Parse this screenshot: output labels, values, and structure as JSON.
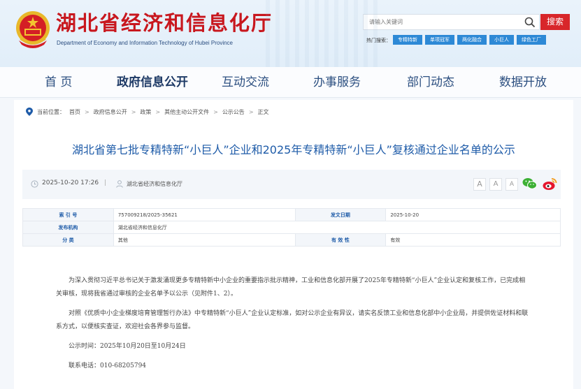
{
  "header": {
    "title": "湖北省经济和信息化厅",
    "subtitle": "Department of Economy and Information Technology of Hubei Province",
    "search_placeholder": "请输入关键词",
    "search_button": "搜索",
    "hot_label": "热门搜索：",
    "hot_tags": [
      "专精特新",
      "单项冠军",
      "两化融合",
      "小巨人",
      "绿色工厂"
    ]
  },
  "nav": {
    "items": [
      "首 页",
      "政府信息公开",
      "互动交流",
      "办事服务",
      "部门动态",
      "数据开放"
    ],
    "active_index": 1
  },
  "breadcrumb": {
    "label": "当前位置：",
    "items": [
      "首页",
      "政府信息公开",
      "政策",
      "其他主动公开文件",
      "公示公告",
      "正文"
    ],
    "separator": ">"
  },
  "article": {
    "title": "湖北省第七批专精特新“小巨人”企业和2025年专精特新“小巨人”复核通过企业名单的公示",
    "date": "2025-10-20 17:26",
    "divider": "|",
    "publisher": "湖北省经济和信息化厅",
    "font_buttons": [
      "A",
      "A",
      "A"
    ]
  },
  "info_table": {
    "index_label": "索 引 号",
    "index_value": "757009218/2025-35621",
    "date_label": "发文日期",
    "date_value": "2025-10-20",
    "org_label": "发布机构",
    "org_value": "湖北省经济和信息化厅",
    "category_label": "分 类",
    "category_value": "其他",
    "validity_label": "有 效 性",
    "validity_value": "有效"
  },
  "body": {
    "p1": "为深入贯彻习近平总书记关于激发涌现更多专精特新中小企业的重要指示批示精神，工业和信息化部开展了2025年专精特新“小巨人”企业认定和复核工作，已完成相关审核，现将我省通过审核的企业名单予以公示（见附件1、2）。",
    "p2": "对照《优质中小企业梯度培育管理暂行办法》中专精特新“小巨人”企业认定标准，如对公示企业有异议，请实名反馈工业和信息化部中小企业局，并提供佐证材料和联系方式，以便核实查证，欢迎社会各界参与监督。",
    "p3": "公示时间：2025年10月20日至10月24日",
    "p4": "联系电话：010-68205794"
  }
}
